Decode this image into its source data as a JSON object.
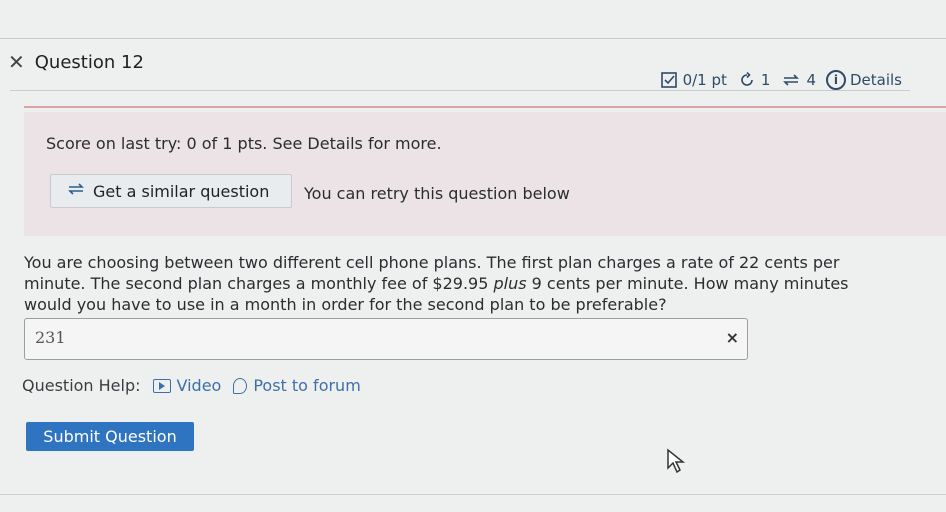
{
  "question": {
    "title": "Question 12",
    "score_label": "0/1 pt",
    "retries": "1",
    "attempts": "4",
    "details_label": "Details"
  },
  "feedback": {
    "score_text": "Score on last try: 0 of 1 pts. See Details for more.",
    "similar_button": "Get a similar question",
    "retry_text": "You can retry this question below"
  },
  "body": {
    "text_1": "You are choosing between two different cell phone plans. The first plan charges a rate of 22 cents per minute. The second plan charges a monthly fee of $29.95 ",
    "text_italic": "plus",
    "text_2": " 9 cents per minute. How many minutes would you have to use in a month in order for the second plan to be preferable?"
  },
  "answer": {
    "value": "231",
    "clear_mark": "×"
  },
  "help": {
    "label": "Question Help:",
    "video_label": "Video",
    "forum_label": "Post to forum"
  },
  "actions": {
    "submit_label": "Submit Question"
  },
  "icons": {
    "close": "close-icon",
    "checkbox": "score-checkbox-icon",
    "retry": "retry-icon",
    "attempts": "attempts-icon",
    "info": "info-icon",
    "similar": "similar-question-icon",
    "video": "video-icon",
    "forum": "forum-icon"
  },
  "colors": {
    "accent": "#2f74c0",
    "link": "#3f6fa8",
    "feedback_panel": "#ebe3e6",
    "meta": "#2f4a6a"
  }
}
